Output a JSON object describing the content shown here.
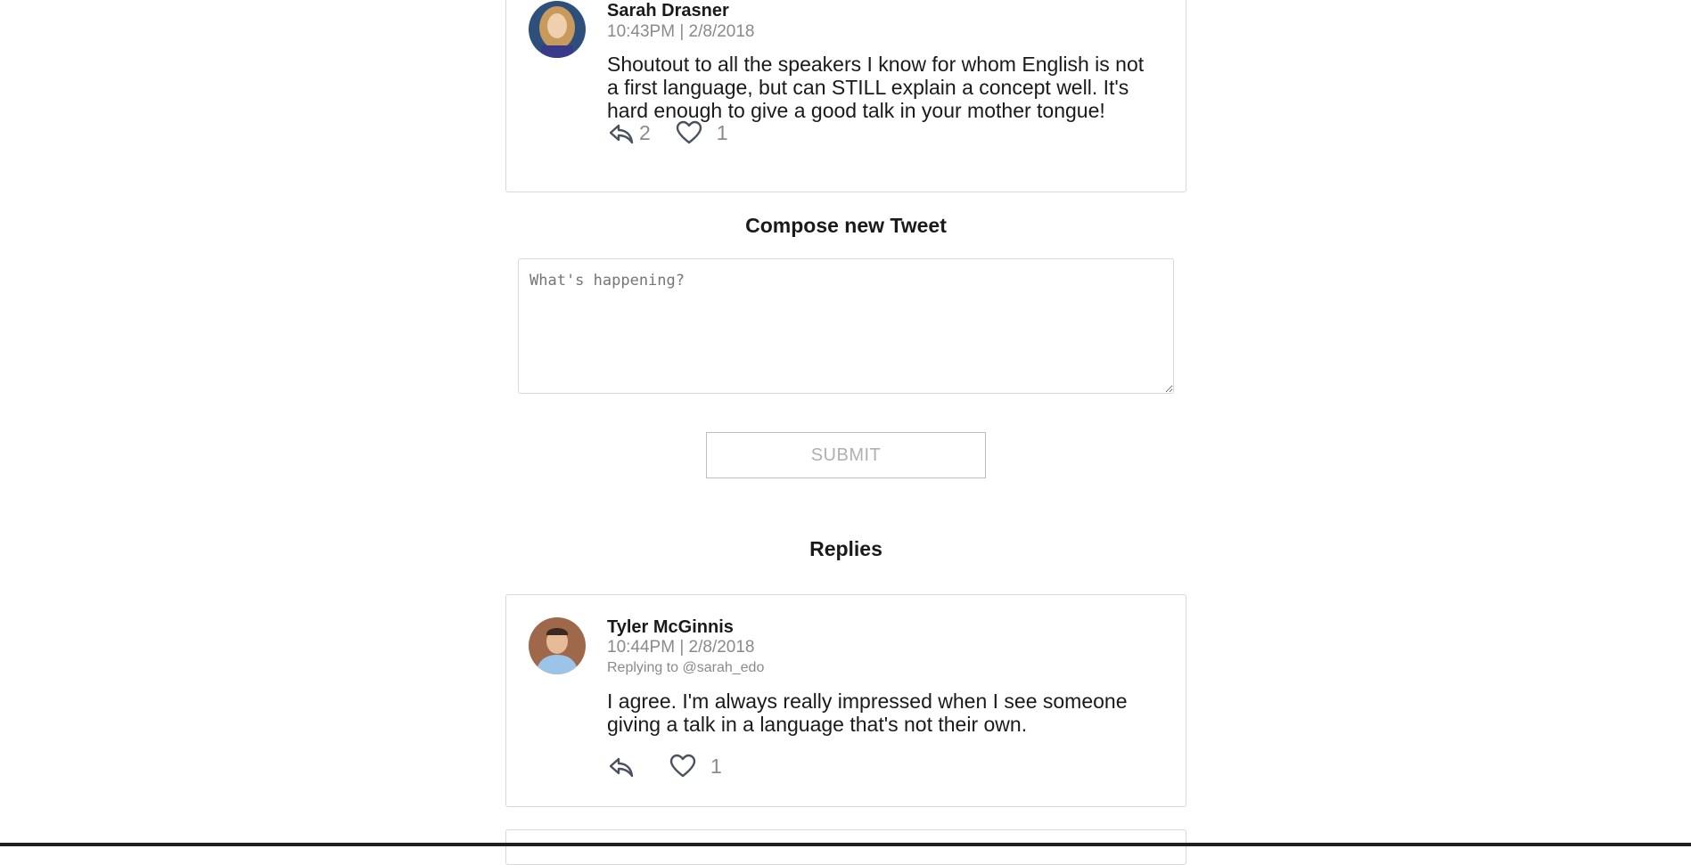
{
  "tweet": {
    "author": "Sarah Drasner",
    "timestamp": "10:43PM | 2/8/2018",
    "text": "Shoutout to all the speakers I know for whom English is not a first language, but can STILL explain a concept well. It's hard enough to give a good talk in your mother tongue!",
    "reply_count": "2",
    "like_count": "1",
    "icons": {
      "reply": "reply-icon",
      "like": "heart-icon"
    }
  },
  "compose": {
    "heading": "Compose new Tweet",
    "placeholder": "What's happening?",
    "submit_label": "SUBMIT"
  },
  "replies": {
    "heading": "Replies",
    "items": [
      {
        "author": "Tyler McGinnis",
        "timestamp": "10:44PM | 2/8/2018",
        "replying_to": "Replying to @sarah_edo",
        "text": "I agree. I'm always really impressed when I see someone giving a talk in a language that's not their own.",
        "like_count": "1"
      }
    ]
  },
  "colors": {
    "border": "#d9d9d9",
    "muted_text": "#8a8a8a",
    "icon": "#4a5260"
  }
}
